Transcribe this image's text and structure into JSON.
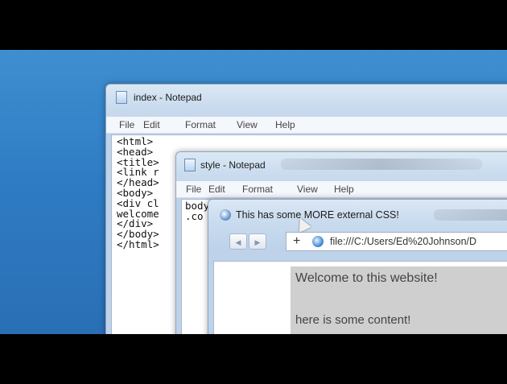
{
  "index_window": {
    "title": "index - Notepad",
    "menu": [
      "File",
      "Edit",
      "Format",
      "View",
      "Help"
    ],
    "lines": [
      "<html>",
      "<head>",
      "<title>",
      "<link r",
      "</head>",
      "<body>",
      "<div cl",
      "welcome",
      "</div>",
      "</body>",
      "</html>"
    ]
  },
  "style_window": {
    "title": "style - Notepad",
    "menu": [
      "File",
      "Edit",
      "Format",
      "View",
      "Help"
    ],
    "lines": [
      "body",
      ".co"
    ]
  },
  "browser_window": {
    "title": "This has some MORE external CSS!",
    "back_glyph": "◀",
    "forward_glyph": "▶",
    "add_glyph": "+",
    "address": "file:///C:/Users/Ed%20Johnson/D",
    "heading": "Welcome to this website!",
    "paragraph": "here is some content!"
  },
  "icons": {
    "app": "notepad-icon",
    "browser": "browser-globe-icon"
  },
  "colors": {
    "desktop": "#2f7cc4",
    "content_bg": "#cfcfcf"
  }
}
